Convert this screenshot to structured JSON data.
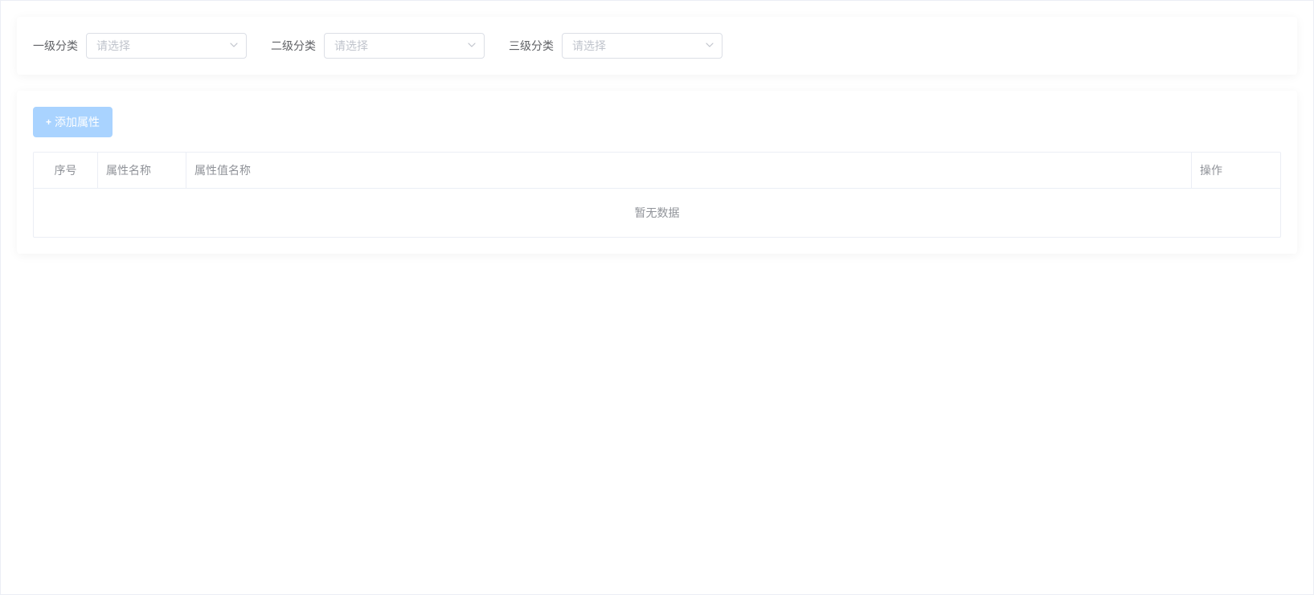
{
  "filters": {
    "level1": {
      "label": "一级分类",
      "placeholder": "请选择"
    },
    "level2": {
      "label": "二级分类",
      "placeholder": "请选择"
    },
    "level3": {
      "label": "三级分类",
      "placeholder": "请选择"
    }
  },
  "actions": {
    "add_attribute": "添加属性"
  },
  "table": {
    "columns": {
      "seq": "序号",
      "attr_name": "属性名称",
      "attr_value_name": "属性值名称",
      "operation": "操作"
    },
    "empty_text": "暂无数据"
  }
}
